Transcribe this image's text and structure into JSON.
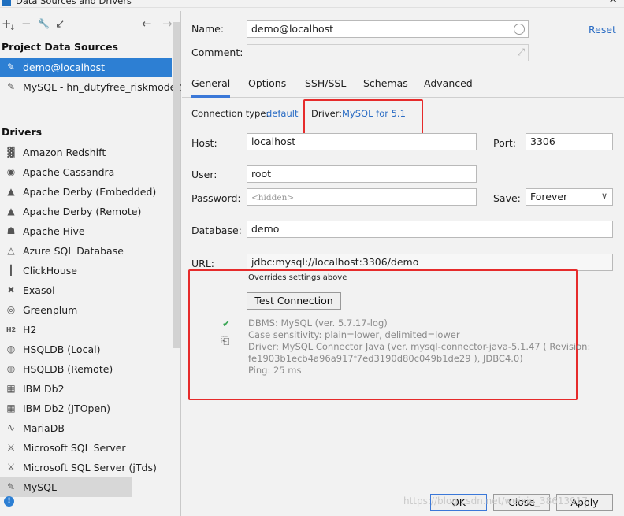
{
  "window": {
    "title": "Data Sources and Drivers",
    "close_glyph": "✕"
  },
  "toolbar": {
    "add": "+",
    "add_arrow": "↓",
    "remove": "−",
    "edit": "🔧",
    "duplicate": "↙",
    "back": "←",
    "forward": "→"
  },
  "left": {
    "project_title": "Project Data Sources",
    "project_items": [
      {
        "label": "demo@localhost",
        "icon": "✎"
      },
      {
        "label": "MySQL - hn_dutyfree_riskmodel@l",
        "icon": "✎"
      }
    ],
    "drivers_title": "Drivers",
    "drivers": [
      {
        "label": "Amazon Redshift",
        "icon": "▓"
      },
      {
        "label": "Apache Cassandra",
        "icon": "◉"
      },
      {
        "label": "Apache Derby (Embedded)",
        "icon": "▲"
      },
      {
        "label": "Apache Derby (Remote)",
        "icon": "▲"
      },
      {
        "label": "Apache Hive",
        "icon": "☗"
      },
      {
        "label": "Azure SQL Database",
        "icon": "△"
      },
      {
        "label": "ClickHouse",
        "icon": "┃"
      },
      {
        "label": "Exasol",
        "icon": "✖"
      },
      {
        "label": "Greenplum",
        "icon": "◎"
      },
      {
        "label": "H2",
        "icon": "H2"
      },
      {
        "label": "HSQLDB (Local)",
        "icon": "◍"
      },
      {
        "label": "HSQLDB (Remote)",
        "icon": "◍"
      },
      {
        "label": "IBM Db2",
        "icon": "▦"
      },
      {
        "label": "IBM Db2 (JTOpen)",
        "icon": "▦"
      },
      {
        "label": "MariaDB",
        "icon": "∿"
      },
      {
        "label": "Microsoft SQL Server",
        "icon": "⚔"
      },
      {
        "label": "Microsoft SQL Server (jTds)",
        "icon": "⚔"
      },
      {
        "label": "MySQL",
        "icon": "✎"
      }
    ],
    "status_icon": "!"
  },
  "right": {
    "name_label": "Name:",
    "name_value": "demo@localhost",
    "reset": "Reset",
    "comment_label": "Comment:",
    "comment_value": "",
    "expand_glyph": "⤢",
    "tabs": [
      "General",
      "Options",
      "SSH/SSL",
      "Schemas",
      "Advanced"
    ],
    "conn_type_label": "Connection type:",
    "conn_type_value": "default",
    "driver_label": "Driver:",
    "driver_value": "MySQL for 5.1",
    "host_label": "Host:",
    "host_value": "localhost",
    "port_label": "Port:",
    "port_value": "3306",
    "user_label": "User:",
    "user_value": "root",
    "password_label": "Password:",
    "password_value": "<hidden>",
    "save_label": "Save:",
    "save_value": "Forever",
    "save_arrow": "∨",
    "database_label": "Database:",
    "database_value": "demo",
    "url_label": "URL:",
    "url_value": "jdbc:mysql://localhost:3306/demo",
    "overrides": "Overrides settings above",
    "test_button": "Test Connection",
    "check_glyph": "✔",
    "copy_glyph": "⎗",
    "info_lines": [
      "DBMS: MySQL (ver. 5.7.17-log)",
      "Case sensitivity: plain=lower, delimited=lower",
      "Driver: MySQL Connector Java (ver. mysql-connector-java-5.1.47 ( Revision:",
      "fe1903b1ecb4a96a917f7ed3190d80c049b1de29 ), JDBC4.0)",
      "Ping: 25 ms"
    ]
  },
  "footer": {
    "ok": "OK",
    "close": "Close",
    "apply": "Apply",
    "watermark": "https://blog.csdn.net/weixin_38613917"
  }
}
